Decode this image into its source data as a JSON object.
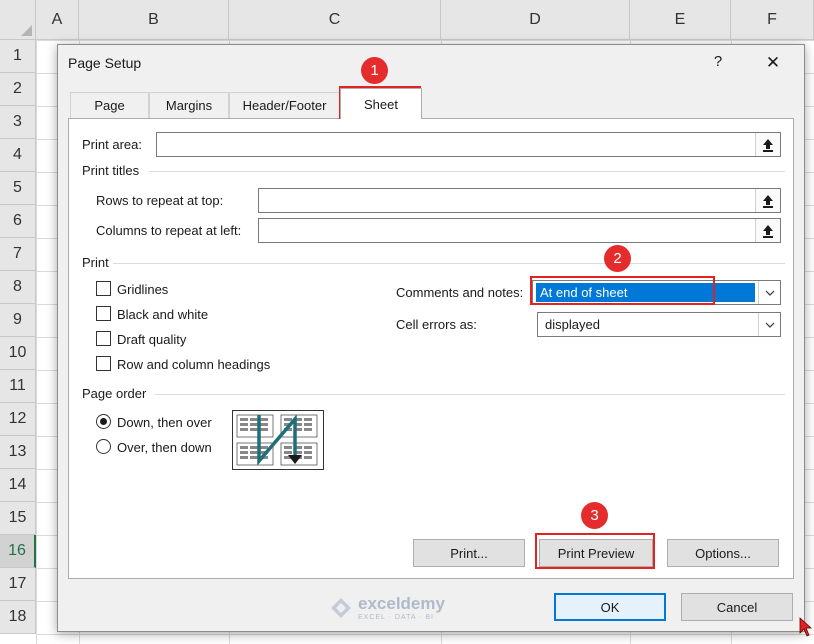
{
  "sheet": {
    "columns": [
      "A",
      "B",
      "C",
      "D",
      "E",
      "F"
    ],
    "rows": [
      "1",
      "2",
      "3",
      "4",
      "5",
      "6",
      "7",
      "8",
      "9",
      "10",
      "11",
      "12",
      "13",
      "14",
      "15",
      "16",
      "17",
      "18"
    ],
    "selected_row": "16"
  },
  "dialog": {
    "title": "Page Setup",
    "help_label": "?",
    "close_label": "✕",
    "tabs": [
      {
        "label": "Page",
        "active": false
      },
      {
        "label": "Margins",
        "active": false
      },
      {
        "label": "Header/Footer",
        "active": false
      },
      {
        "label": "Sheet",
        "active": true
      }
    ],
    "print_area_label": "Print area:",
    "print_area_value": "",
    "print_titles_label": "Print titles",
    "rows_repeat_label": "Rows to repeat at top:",
    "rows_repeat_value": "",
    "cols_repeat_label": "Columns to repeat at left:",
    "cols_repeat_value": "",
    "print_group_label": "Print",
    "checkboxes": [
      {
        "label": "Gridlines",
        "checked": false
      },
      {
        "label": "Black and white",
        "checked": false
      },
      {
        "label": "Draft quality",
        "checked": false
      },
      {
        "label": "Row and column headings",
        "checked": false
      }
    ],
    "comments_label": "Comments and notes:",
    "comments_value": "At end of sheet",
    "cell_errors_label": "Cell errors as:",
    "cell_errors_value": "displayed",
    "page_order_label": "Page order",
    "radios": [
      {
        "label": "Down, then over",
        "selected": true
      },
      {
        "label": "Over, then down",
        "selected": false
      }
    ],
    "buttons": {
      "print": "Print...",
      "print_preview": "Print Preview",
      "options": "Options...",
      "ok": "OK",
      "cancel": "Cancel"
    }
  },
  "annotations": {
    "step1": "1",
    "step2": "2",
    "step3": "3"
  },
  "watermark": {
    "name": "exceldemy",
    "tagline": "EXCEL · DATA · BI"
  },
  "colors": {
    "highlight": "#0078d7",
    "annotation_red": "#e52c2c",
    "selected_row_text": "#217346"
  }
}
